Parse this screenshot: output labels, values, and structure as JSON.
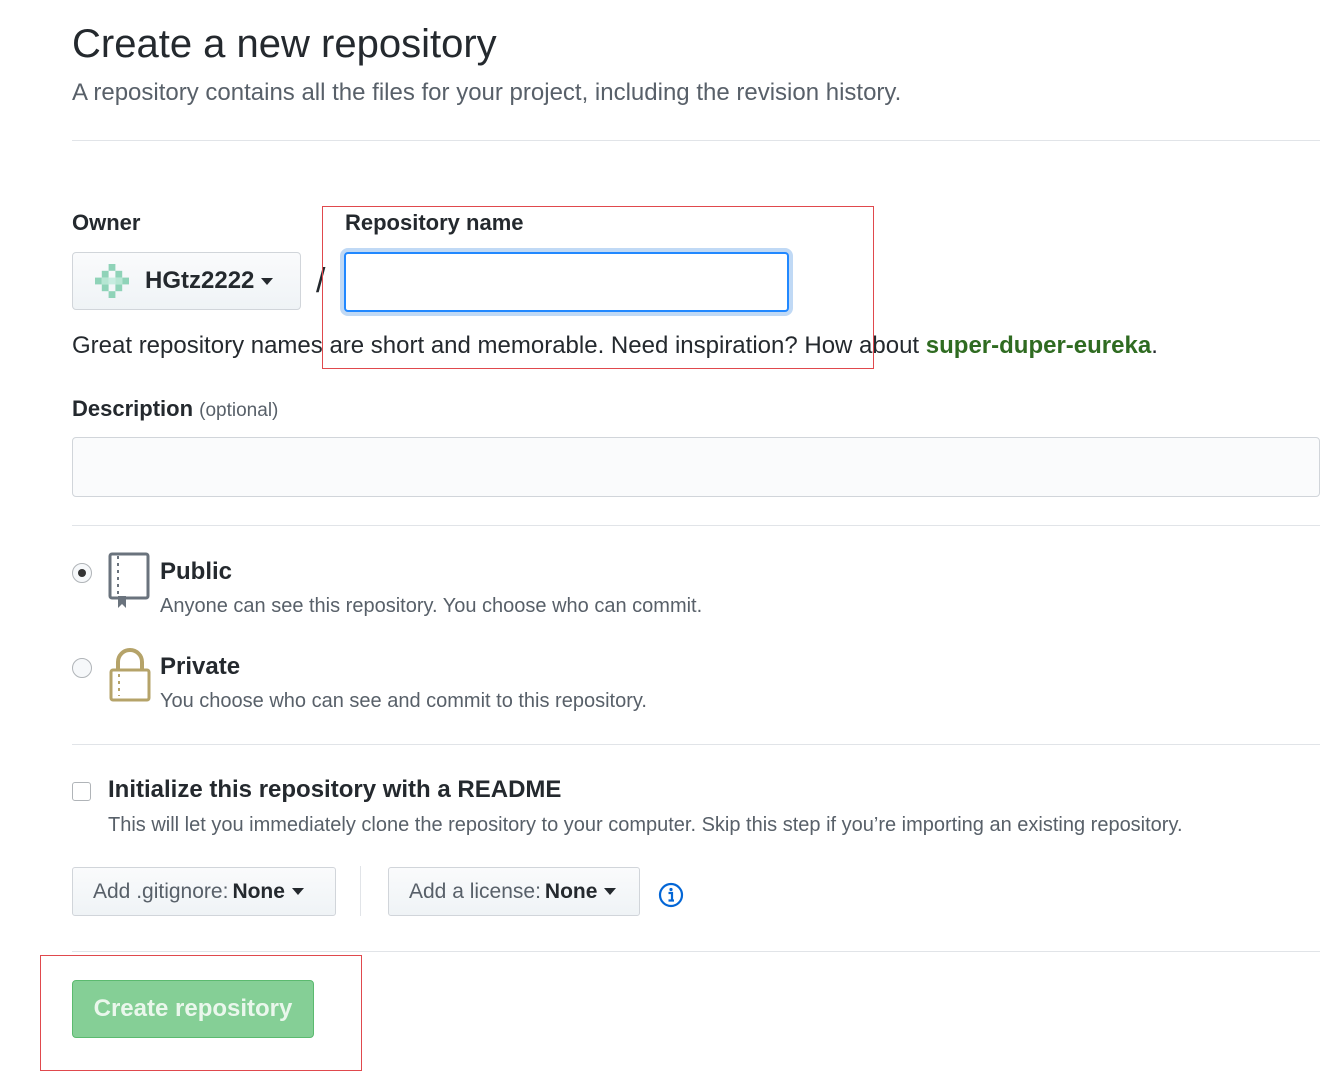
{
  "header": {
    "title": "Create a new repository",
    "subtitle": "A repository contains all the files for your project, including the revision history."
  },
  "owner": {
    "label": "Owner",
    "name": "HGtz2222"
  },
  "separator": "/",
  "repo_name": {
    "label": "Repository name",
    "value": "",
    "placeholder": ""
  },
  "hint": {
    "prefix": "Great repository names are short and memorable. Need inspiration? How about ",
    "suggestion": "super-duper-eureka",
    "suffix": "."
  },
  "description": {
    "label": "Description",
    "optional": "(optional)",
    "value": "",
    "placeholder": ""
  },
  "visibility": {
    "selected": "public",
    "options": [
      {
        "id": "public",
        "title": "Public",
        "desc": "Anyone can see this repository. You choose who can commit."
      },
      {
        "id": "private",
        "title": "Private",
        "desc": "You choose who can see and commit to this repository."
      }
    ]
  },
  "readme": {
    "checked": false,
    "title": "Initialize this repository with a README",
    "desc": "This will let you immediately clone the repository to your computer. Skip this step if you’re importing an existing repository."
  },
  "gitignore": {
    "prefix": "Add .gitignore:",
    "value": "None"
  },
  "license": {
    "prefix": "Add a license:",
    "value": "None"
  },
  "icons": {
    "owner_avatar": "identicon-avatar",
    "public": "repo-book-icon",
    "private": "lock-icon",
    "info": "info-icon",
    "dropdown": "caret-down-icon"
  },
  "colors": {
    "primary_button": "#85cf96",
    "focus_border": "#2188ff",
    "suggestion": "#2f6b21",
    "annotation": "#e0494d"
  },
  "submit": {
    "label": "Create repository",
    "enabled": false
  }
}
